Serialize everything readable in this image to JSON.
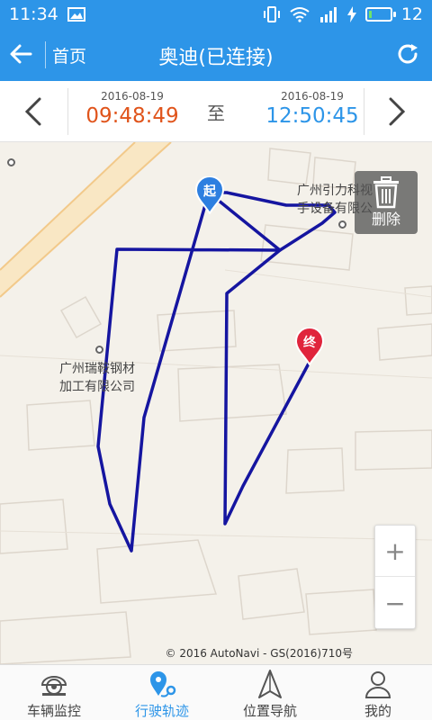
{
  "status_bar": {
    "time": "11:34",
    "battery": "12",
    "battery_level": 0.12
  },
  "app_bar": {
    "home_label": "首页",
    "title": "奥迪(已连接)"
  },
  "time_range": {
    "start_date": "2016-08-19",
    "start_time": "09:48:49",
    "separator": "至",
    "end_date": "2016-08-19",
    "end_time": "12:50:45"
  },
  "map": {
    "poi_1_line1": "广州引力科视",
    "poi_1_line2": "手设备有限公",
    "poi_2_line1": "广州瑞鞍钢材",
    "poi_2_line2": "加工有限公司",
    "start_marker": "起",
    "end_marker": "终",
    "delete_label": "删除",
    "zoom_in": "+",
    "zoom_out": "−",
    "copyright": "© 2016 AutoNavi - GS(2016)710号",
    "colors": {
      "track": "#1515a0",
      "start_marker": "#2d7fe0",
      "end_marker": "#e0243c"
    }
  },
  "bottom_nav": [
    {
      "label": "车辆监控",
      "icon": "camera-icon"
    },
    {
      "label": "行驶轨迹",
      "icon": "track-pin-icon"
    },
    {
      "label": "位置导航",
      "icon": "navigation-arrow-icon"
    },
    {
      "label": "我的",
      "icon": "person-icon"
    }
  ],
  "accent": "#2d95e8"
}
